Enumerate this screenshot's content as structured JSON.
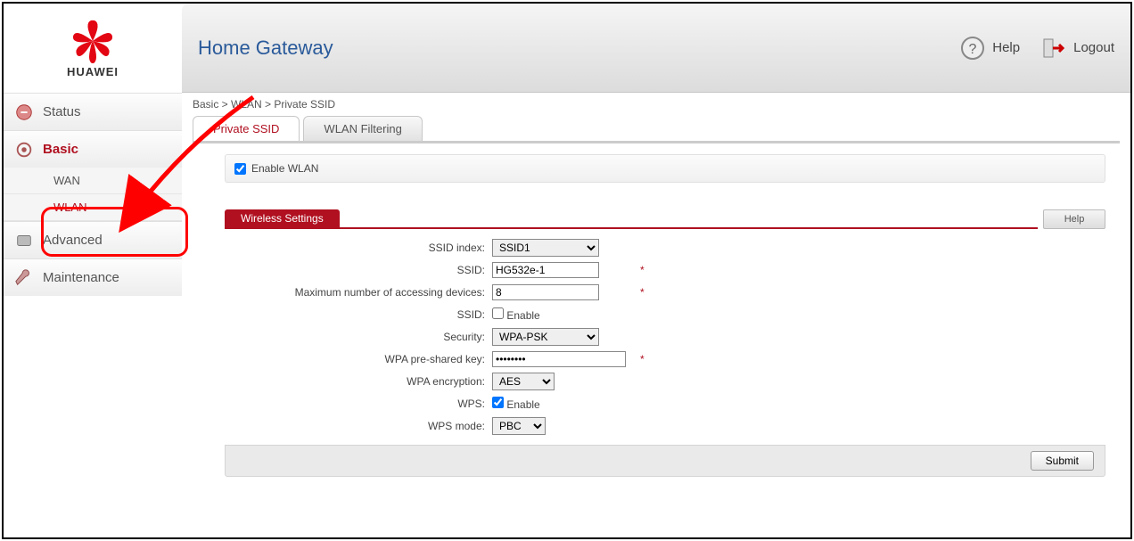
{
  "brand": "HUAWEI",
  "header": {
    "title": "Home Gateway",
    "help": "Help",
    "logout": "Logout"
  },
  "breadcrumb": "Basic > WLAN > Private SSID",
  "tabs": {
    "t0": "Private SSID",
    "t1": "WLAN Filtering"
  },
  "nav": {
    "status": "Status",
    "basic": "Basic",
    "wan": "WAN",
    "wlan": "WLAN",
    "advanced": "Advanced",
    "maintenance": "Maintenance"
  },
  "enable_wlan_label": "Enable WLAN",
  "section": {
    "title": "Wireless Settings",
    "help": "Help"
  },
  "form": {
    "ssid_index_label": "SSID index:",
    "ssid_index_value": "SSID1",
    "ssid_label": "SSID:",
    "ssid_value": "HG532e-1",
    "max_dev_label": "Maximum number of accessing devices:",
    "max_dev_value": "8",
    "ssid2_label": "SSID:",
    "ssid2_enable": "Enable",
    "security_label": "Security:",
    "security_value": "WPA-PSK",
    "psk_label": "WPA pre-shared key:",
    "psk_value": "••••••••",
    "enc_label": "WPA encryption:",
    "enc_value": "AES",
    "wps_label": "WPS:",
    "wps_enable": "Enable",
    "wps_mode_label": "WPS mode:",
    "wps_mode_value": "PBC"
  },
  "submit": "Submit"
}
